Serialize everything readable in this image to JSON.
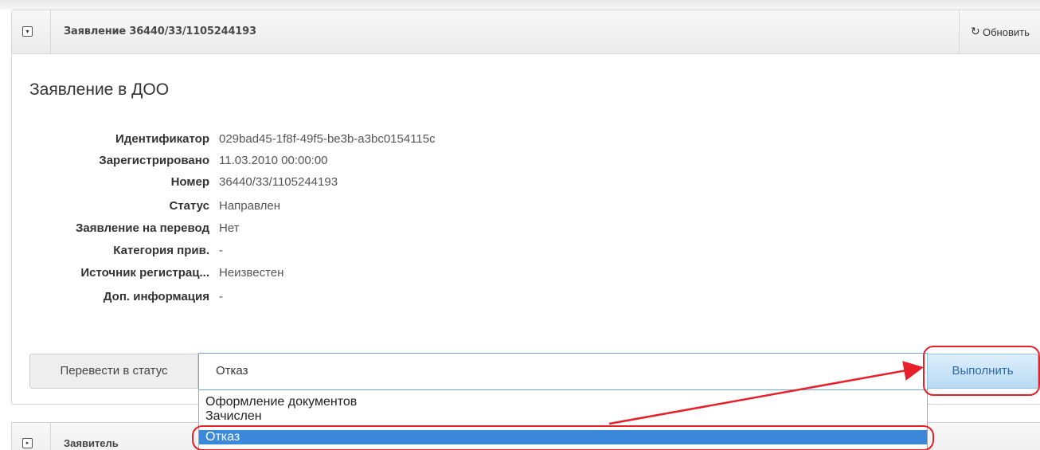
{
  "panel": {
    "title": "Заявление 36440/33/1105244193",
    "refresh_label": "Обновить",
    "doc_title": "Заявление в ДОО"
  },
  "fields": [
    {
      "label": "Идентификатор",
      "value": "029bad45-1f8f-49f5-be3b-a3bc0154115c"
    },
    {
      "label": "Зарегистрировано",
      "value": "11.03.2010 00:00:00"
    },
    {
      "label": "Номер",
      "value": "36440/33/1105244193"
    },
    {
      "label": "Статус",
      "value": "Направлен"
    },
    {
      "label": "Заявление на перевод",
      "value": "Нет"
    },
    {
      "label": "Категория прив.",
      "value": "-"
    },
    {
      "label": "Источник регистрац...",
      "value": "Неизвестен"
    },
    {
      "label": "Доп. информация",
      "value": "-"
    }
  ],
  "status_form": {
    "button_label": "Перевести в статус",
    "selected_value": "Отказ",
    "execute_label": "Выполнить",
    "options": [
      "Оформление документов",
      "Зачислен",
      "Отказ"
    ],
    "highlighted_option": "Отказ"
  },
  "panel2": {
    "title": "Заявитель"
  },
  "colors": {
    "annotation": "#e8202a",
    "selection": "#3b88db",
    "focus_border": "#6aa6dc"
  },
  "icons": {
    "collapse": "minus-square-icon",
    "refresh": "refresh-icon",
    "expand": "plus-square-icon"
  }
}
